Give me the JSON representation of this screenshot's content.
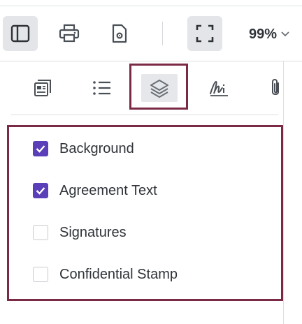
{
  "toolbar": {
    "buttons": [
      {
        "icon": "sidebar-toggle-icon",
        "active": true
      },
      {
        "icon": "printer-icon",
        "active": false
      },
      {
        "icon": "document-settings-icon",
        "active": false
      },
      {
        "icon": "fullscreen-icon",
        "active": true
      }
    ],
    "zoom_value": "99%",
    "zoom_icon": "chevron-down-icon"
  },
  "sidebar": {
    "tabs": [
      {
        "icon": "thumbnails-icon",
        "active": false
      },
      {
        "icon": "outline-list-icon",
        "active": false
      },
      {
        "icon": "layers-icon",
        "active": true
      },
      {
        "icon": "signature-icon",
        "active": false
      },
      {
        "icon": "attachment-icon",
        "active": false
      }
    ],
    "layers": [
      {
        "label": "Background",
        "checked": true
      },
      {
        "label": "Agreement Text",
        "checked": true
      },
      {
        "label": "Signatures",
        "checked": false
      },
      {
        "label": "Confidential Stamp",
        "checked": false
      }
    ]
  },
  "colors": {
    "accent": "#5a3fb8",
    "highlight_border": "#7b2a45",
    "active_bg": "#e3e5e8",
    "icon": "#4a4f56"
  }
}
